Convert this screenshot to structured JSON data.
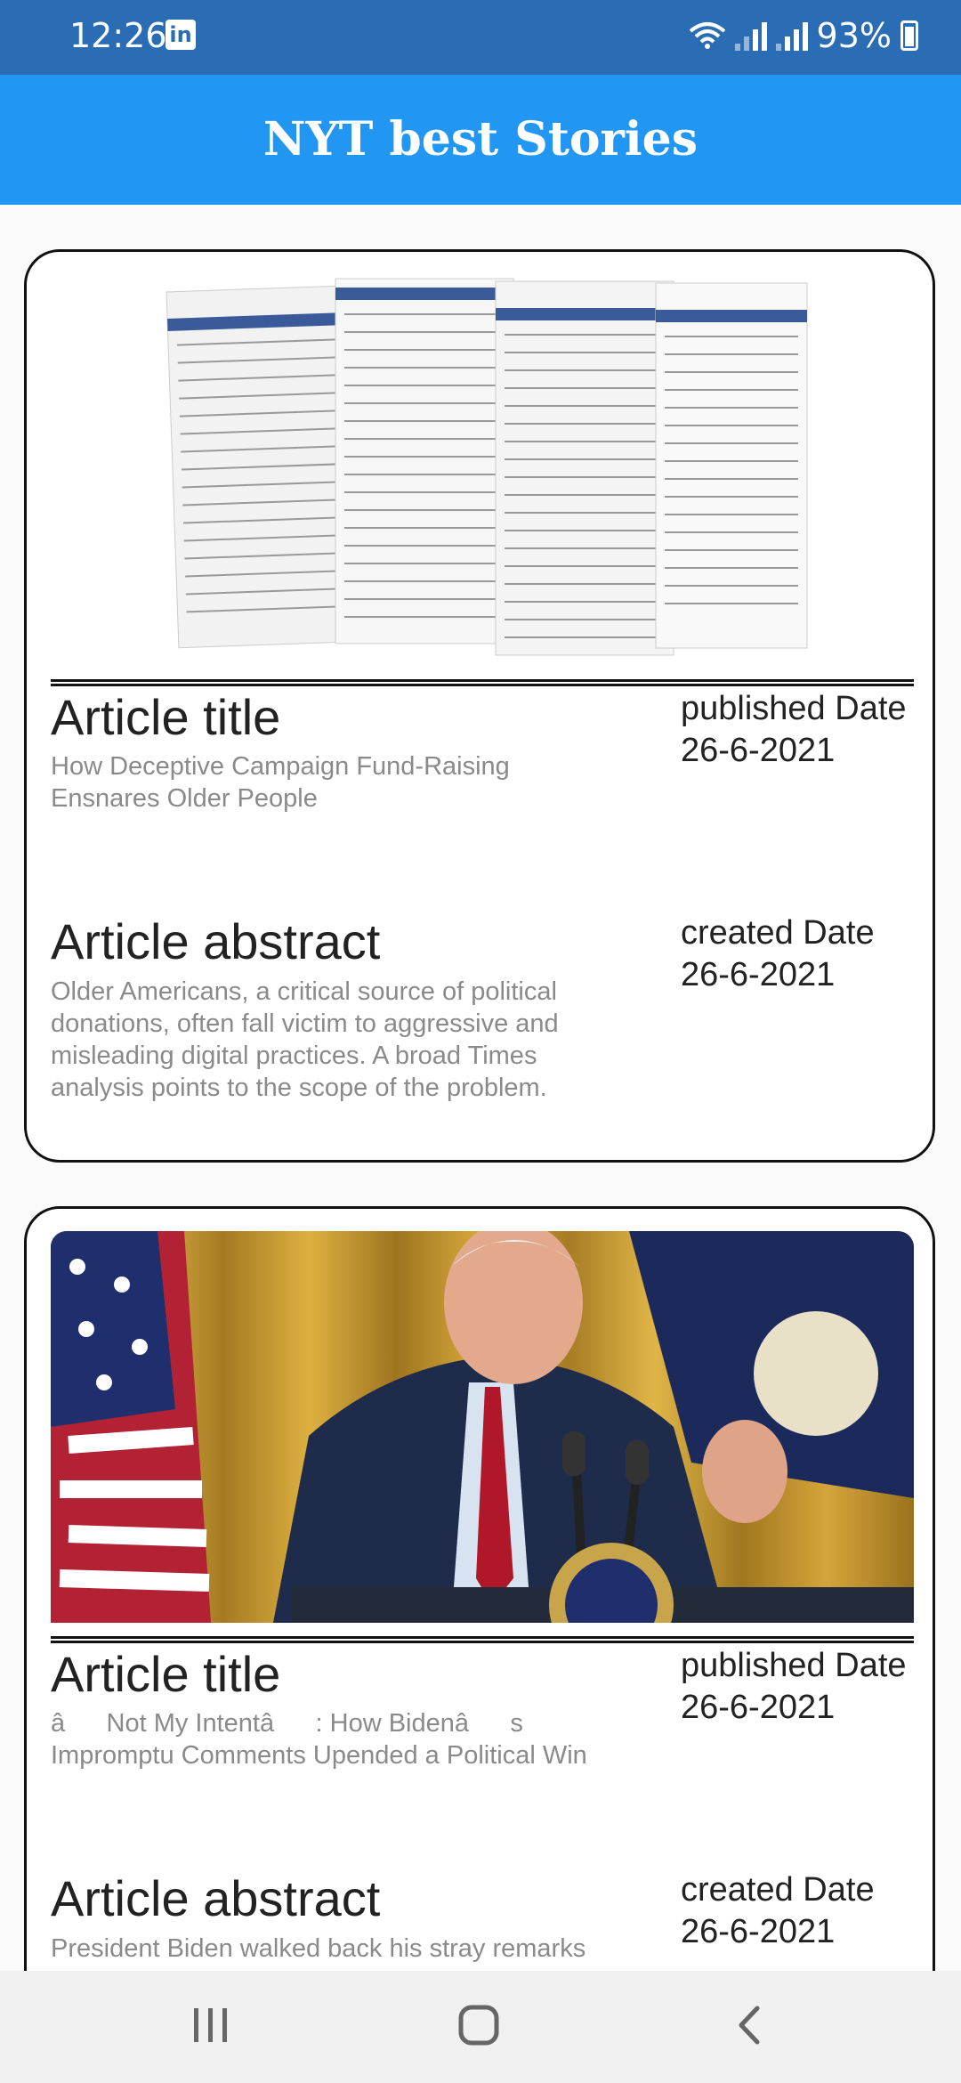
{
  "status_bar": {
    "time": "12:26",
    "app_icon": "linkedin-icon",
    "battery": "93%"
  },
  "app_bar": {
    "title": "NYT best Stories"
  },
  "articles": [
    {
      "title_label": "Article title",
      "title": "How Deceptive Campaign Fund-Raising Ensnares Older People",
      "published_label": "published Date",
      "published_date": "26-6-2021",
      "abstract_label": "Article abstract",
      "abstract": "Older Americans, a critical source of political donations, often fall victim to aggressive and misleading digital practices. A broad Times analysis points to the scope of the problem.",
      "created_label": "created Date",
      "created_date": "26-6-2021"
    },
    {
      "title_label": "Article title",
      "title": "âNot My Intentâ: How Bidenâs Impromptu Comments Upended a Political Win",
      "published_label": "published Date",
      "published_date": "26-6-2021",
      "abstract_label": "Article abstract",
      "abstract": "President Biden walked back his stray remarks",
      "created_label": "created Date",
      "created_date": "26-6-2021"
    }
  ],
  "colors": {
    "status_bar": "#2a6db4",
    "app_bar": "#2196f3",
    "secondary_text": "#8a8a8a"
  }
}
